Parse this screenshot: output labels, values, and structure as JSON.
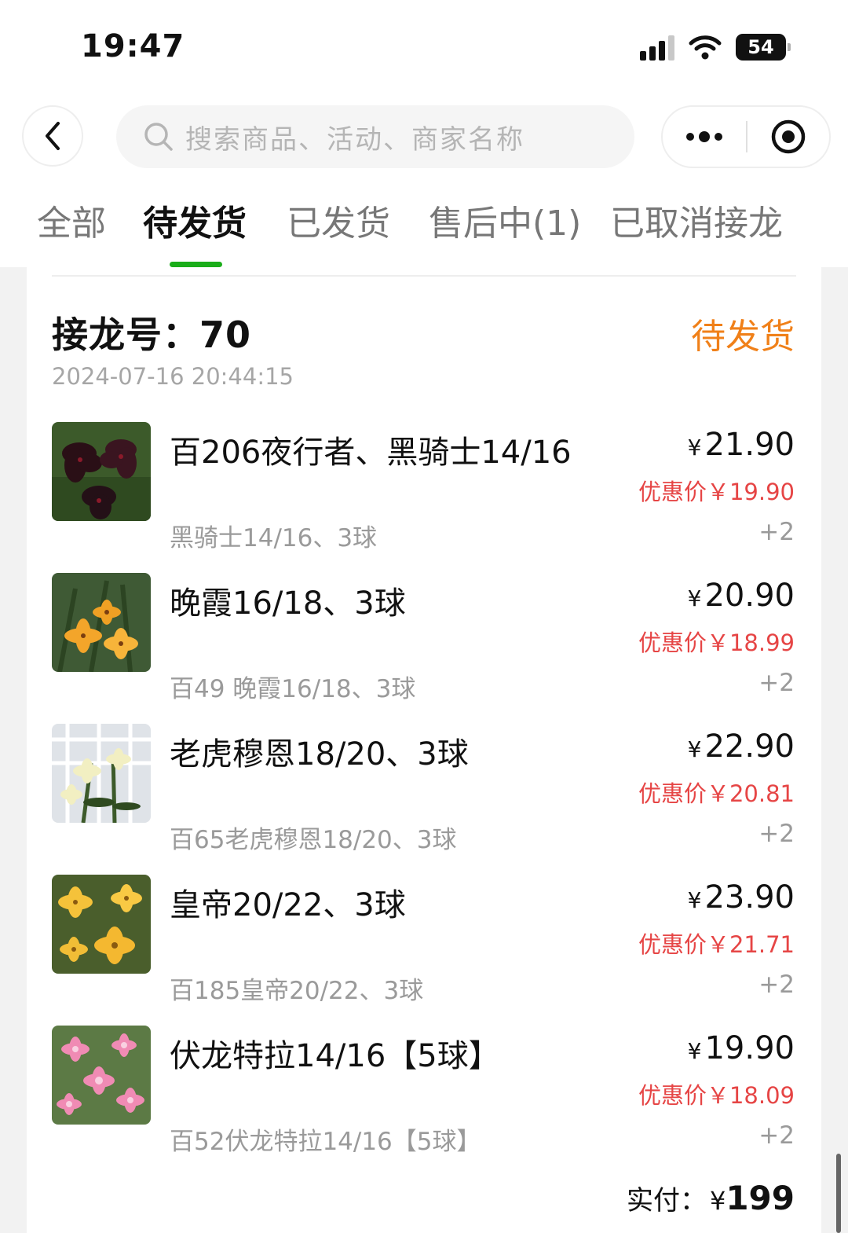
{
  "status_bar": {
    "time": "19:47",
    "battery": "54"
  },
  "nav": {
    "search_placeholder": "搜索商品、活动、商家名称"
  },
  "tabs": [
    {
      "label": "全部"
    },
    {
      "label": "待发货"
    },
    {
      "label": "已发货"
    },
    {
      "label": "售后中(1)"
    },
    {
      "label": "已取消接龙"
    }
  ],
  "order": {
    "label": "接龙号：",
    "number": "70",
    "status": "待发货",
    "time": "2024-07-16 20:44:15",
    "items": [
      {
        "name": "百206夜行者、黑骑士14/16",
        "spec": "黑骑士14/16、3球",
        "currency": "¥",
        "price": "21.90",
        "discount": "优惠价￥19.90",
        "qty": "+2"
      },
      {
        "name": "晚霞16/18、3球",
        "spec": "百49 晚霞16/18、3球",
        "currency": "¥",
        "price": "20.90",
        "discount": "优惠价￥18.99",
        "qty": "+2"
      },
      {
        "name": "老虎穆恩18/20、3球",
        "spec": "百65老虎穆恩18/20、3球",
        "currency": "¥",
        "price": "22.90",
        "discount": "优惠价￥20.81",
        "qty": "+2"
      },
      {
        "name": "皇帝20/22、3球",
        "spec": "百185皇帝20/22、3球",
        "currency": "¥",
        "price": "23.90",
        "discount": "优惠价￥21.71",
        "qty": "+2"
      },
      {
        "name": "伏龙特拉14/16【5球】",
        "spec": "百52伏龙特拉14/16【5球】",
        "currency": "¥",
        "price": "19.90",
        "discount": "优惠价￥18.09",
        "qty": "+2"
      }
    ],
    "total_label": "实付：",
    "total_currency": "¥",
    "total_amount": "199"
  },
  "colors": {
    "accent_green": "#1aad19",
    "status_orange": "#f08019",
    "discount_red": "#e64545"
  }
}
